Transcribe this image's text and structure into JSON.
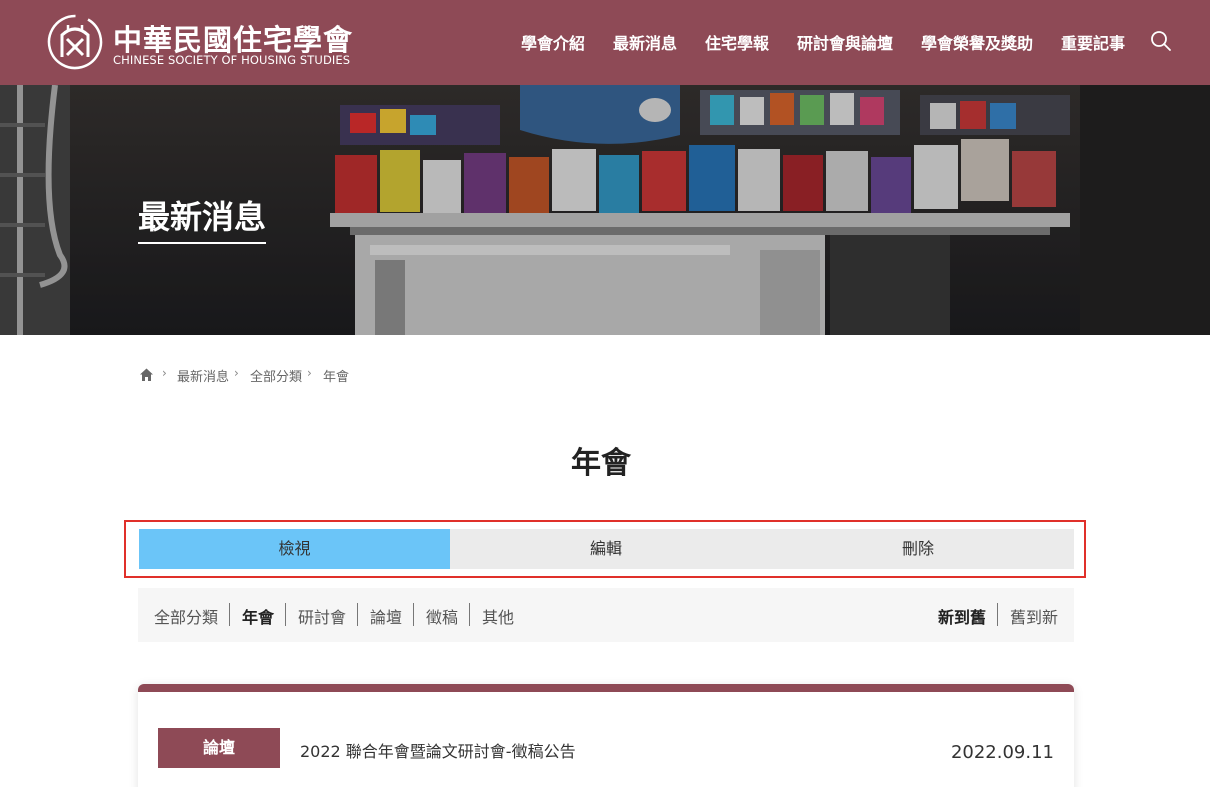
{
  "site": {
    "name_cn": "中華民國住宅學會",
    "name_en": "CHINESE SOCIETY OF HOUSING STUDIES",
    "brand_color": "#8e4a56"
  },
  "nav": {
    "items": [
      {
        "label": "學會介紹"
      },
      {
        "label": "最新消息"
      },
      {
        "label": "住宅學報"
      },
      {
        "label": "研討會與論壇"
      },
      {
        "label": "學會榮譽及獎助"
      },
      {
        "label": "重要記事"
      }
    ],
    "search_icon": "search-icon"
  },
  "banner": {
    "title": "最新消息"
  },
  "breadcrumb": {
    "home_icon": "home-icon",
    "items": [
      "最新消息",
      "全部分類",
      "年會"
    ]
  },
  "page": {
    "title": "年會"
  },
  "tabs": {
    "view": "檢視",
    "edit": "編輯",
    "delete": "刪除",
    "active": "檢視",
    "active_color": "#6bc5f8"
  },
  "filters": {
    "categories": [
      "全部分類",
      "年會",
      "研討會",
      "論壇",
      "徵稿",
      "其他"
    ],
    "active_category": "年會",
    "sort": [
      "新到舊",
      "舊到新"
    ],
    "active_sort": "新到舊"
  },
  "articles": [
    {
      "tag": "論壇",
      "title": "2022 聯合年會暨論文研討會-徵稿公告",
      "date": "2022.09.11"
    }
  ]
}
